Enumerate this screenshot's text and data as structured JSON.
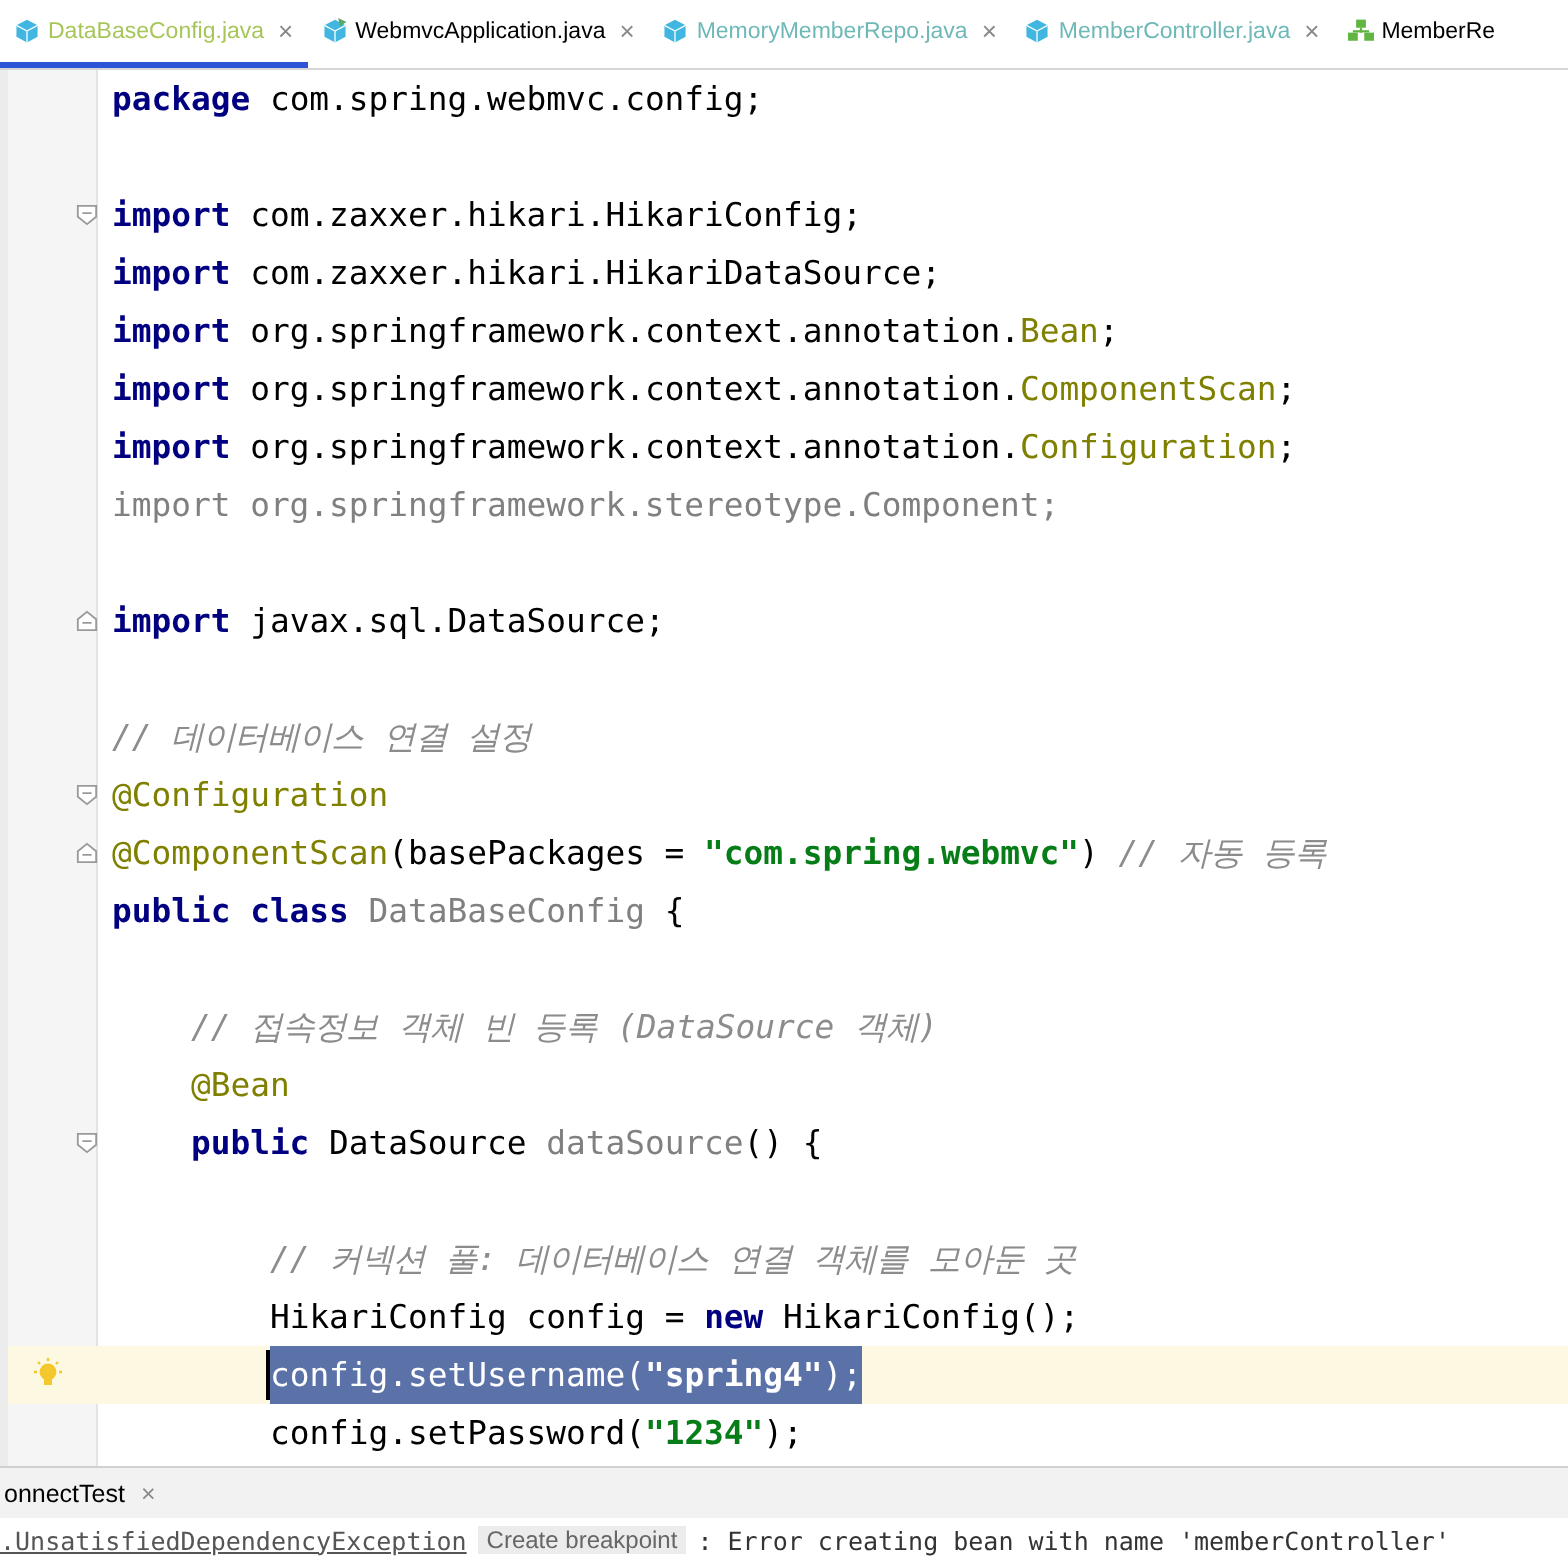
{
  "tabs": [
    {
      "label": "DataBaseConfig.java",
      "kind": "class",
      "color": "#a7c65a",
      "selected": true,
      "closable": true
    },
    {
      "label": "WebmvcApplication.java",
      "kind": "app",
      "color": "#000000",
      "selected": false,
      "closable": true
    },
    {
      "label": "MemoryMemberRepo.java",
      "kind": "class",
      "color": "#6fb8b8",
      "selected": false,
      "closable": true
    },
    {
      "label": "MemberController.java",
      "kind": "class",
      "color": "#6fb8b8",
      "selected": false,
      "closable": true
    },
    {
      "label": "MemberRe",
      "kind": "structure",
      "color": "#000000",
      "selected": false,
      "closable": false
    }
  ],
  "close_glyph": "×",
  "lines": [
    {
      "selected": false,
      "tokens": [
        {
          "kind": "keyword",
          "text": "package"
        },
        {
          "kind": "plain",
          "text": " com.spring.webmvc.config;"
        }
      ]
    },
    {
      "selected": false
    },
    {
      "selected": false,
      "kind": "fold-start",
      "tokens": [
        {
          "kind": "keyword",
          "text": "import"
        },
        {
          "kind": "plain",
          "text": " com.zaxxer.hikari.HikariConfig;"
        }
      ]
    },
    {
      "selected": false,
      "tokens": [
        {
          "kind": "keyword",
          "text": "import"
        },
        {
          "kind": "plain",
          "text": " com.zaxxer.hikari.HikariDataSource;"
        }
      ]
    },
    {
      "selected": false,
      "tokens": [
        {
          "kind": "keyword",
          "text": "import"
        },
        {
          "kind": "plain",
          "text": " org.springframework.context.annotation."
        },
        {
          "kind": "annotation",
          "text": "Bean"
        },
        {
          "kind": "plain",
          "text": ";"
        }
      ]
    },
    {
      "selected": false,
      "tokens": [
        {
          "kind": "keyword",
          "text": "import"
        },
        {
          "kind": "plain",
          "text": " org.springframework.context.annotation."
        },
        {
          "kind": "annotation",
          "text": "ComponentScan"
        },
        {
          "kind": "plain",
          "text": ";"
        }
      ]
    },
    {
      "selected": false,
      "tokens": [
        {
          "kind": "keyword",
          "text": "import"
        },
        {
          "kind": "plain",
          "text": " org.springframework.context.annotation."
        },
        {
          "kind": "annotation",
          "text": "Configuration"
        },
        {
          "kind": "plain",
          "text": ";"
        }
      ]
    },
    {
      "selected": false,
      "tokens": [
        {
          "kind": "unused",
          "text": "import org.springframework.stereotype.Component;"
        }
      ]
    },
    {
      "selected": false
    },
    {
      "selected": false,
      "kind": "fold-end",
      "tokens": [
        {
          "kind": "keyword",
          "text": "import"
        },
        {
          "kind": "plain",
          "text": " javax.sql.DataSource;"
        }
      ]
    },
    {
      "selected": false
    },
    {
      "selected": false,
      "tokens": [
        {
          "kind": "comment",
          "text": "// 데이터베이스 연결 설정"
        }
      ]
    },
    {
      "selected": false,
      "kind": "fold-start",
      "tokens": [
        {
          "kind": "annotation",
          "text": "@Configuration"
        }
      ]
    },
    {
      "selected": false,
      "kind": "fold-end",
      "tokens": [
        {
          "kind": "annotation",
          "text": "@ComponentScan"
        },
        {
          "kind": "plain",
          "text": "(basePackages = "
        },
        {
          "kind": "string",
          "text": "\"com.spring.webmvc\""
        },
        {
          "kind": "plain",
          "text": ") "
        },
        {
          "kind": "comment",
          "text": "// 자동 등록"
        }
      ]
    },
    {
      "selected": false,
      "tokens": [
        {
          "kind": "keyword",
          "text": "public class "
        },
        {
          "kind": "unused",
          "text": "DataBaseConfig"
        },
        {
          "kind": "plain",
          "text": " {"
        }
      ],
      "children": [
        {
          "selected": false
        },
        {
          "selected": false,
          "tokens": [
            {
              "kind": "comment",
              "text": "// 접속정보 객체 빈 등록 (DataSource 객체)"
            }
          ]
        },
        {
          "selected": false,
          "tokens": [
            {
              "kind": "annotation",
              "text": "@Bean"
            }
          ]
        },
        {
          "selected": false,
          "kind": "fold-start",
          "tokens": [
            {
              "kind": "keyword",
              "text": "public"
            },
            {
              "kind": "plain",
              "text": " DataSource "
            },
            {
              "kind": "unused",
              "text": "dataSource"
            },
            {
              "kind": "plain",
              "text": "() {"
            }
          ],
          "children": [
            {
              "selected": false
            },
            {
              "selected": false,
              "tokens": [
                {
                  "kind": "comment",
                  "text": "// 커넥션 풀: 데이터베이스 연결 객체를 모아둔 곳"
                }
              ]
            },
            {
              "selected": false,
              "tokens": [
                {
                  "kind": "plain",
                  "text": "HikariConfig config = "
                },
                {
                  "kind": "keyword",
                  "text": "new"
                },
                {
                  "kind": "plain",
                  "text": " HikariConfig();"
                }
              ]
            },
            {
              "selected": true,
              "intention": true,
              "tokens": [
                {
                  "kind": "plain",
                  "text": "config.setUsername("
                },
                {
                  "kind": "string",
                  "text": "\"spring4\""
                },
                {
                  "kind": "plain",
                  "text": ");"
                }
              ]
            },
            {
              "selected": false,
              "tokens": [
                {
                  "kind": "plain",
                  "text": "config.setPassword("
                },
                {
                  "kind": "string",
                  "text": "\"1234\""
                },
                {
                  "kind": "plain",
                  "text": ");"
                }
              ]
            }
          ]
        }
      ]
    }
  ],
  "bottom_panel": {
    "tab": "onnectTest",
    "console": {
      "exception": ".UnsatisfiedDependencyException",
      "action": "Create breakpoint",
      "message": ": Error creating bean with name 'memberController'"
    }
  }
}
